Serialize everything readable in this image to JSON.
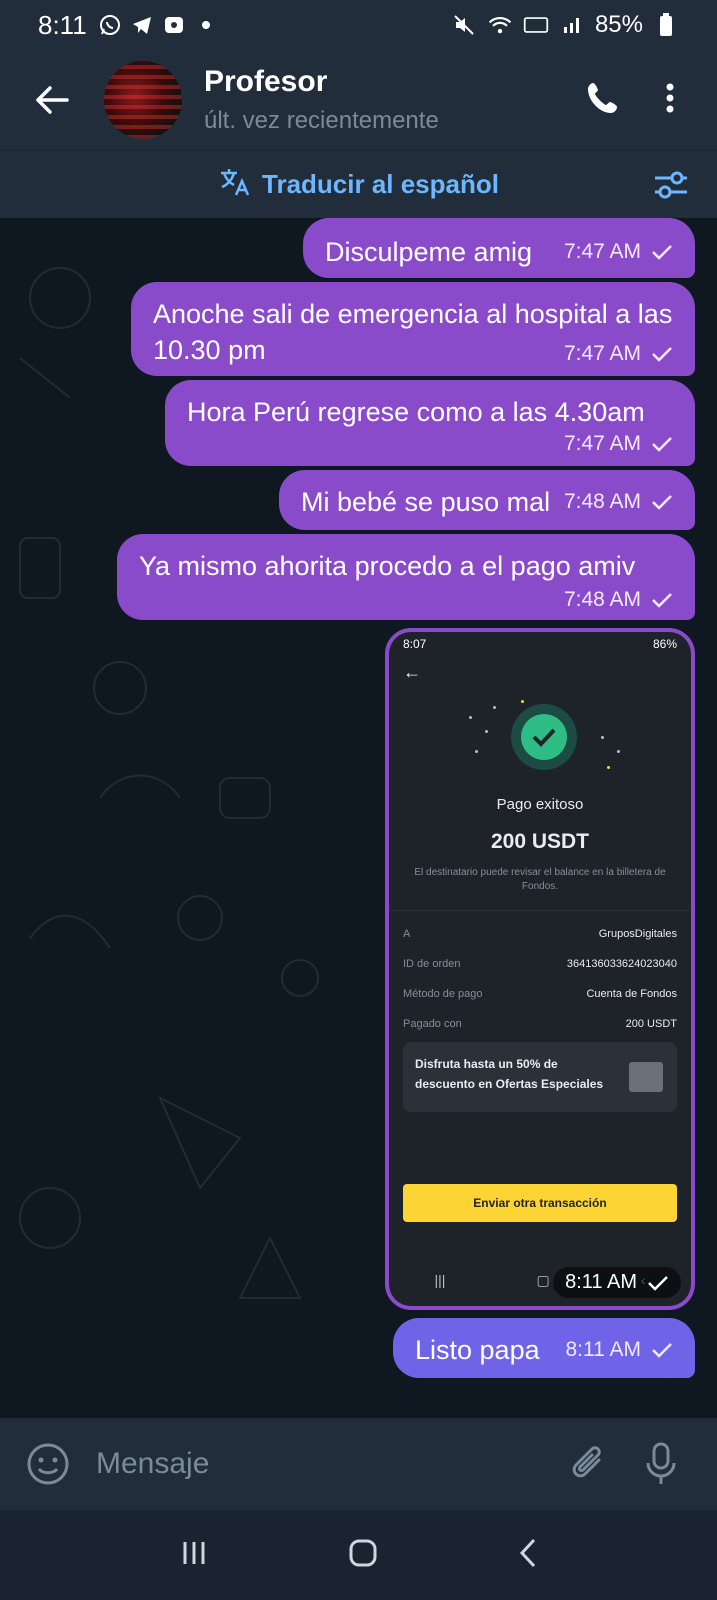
{
  "status_bar": {
    "time": "8:11",
    "battery": "85%"
  },
  "header": {
    "title": "Profesor",
    "subtitle": "últ. vez recientemente"
  },
  "translate": {
    "label": "Traducir al español"
  },
  "messages": [
    {
      "text": "Disculpeme amig",
      "time": "7:47 AM"
    },
    {
      "text": "Anoche sali de emergencia al hospital a las 10.30 pm",
      "time": "7:47 AM"
    },
    {
      "text": "Hora Perú regrese como a las 4.30am",
      "time": "7:47 AM"
    },
    {
      "text": "Mi bebé se puso mal",
      "time": "7:48 AM"
    },
    {
      "text": "Ya mismo ahorita procedo a el pago amiv",
      "time": "7:48 AM"
    },
    {
      "text": "Listo papa",
      "time": "8:11 AM"
    }
  ],
  "image_message": {
    "time": "8:11 AM",
    "screenshot": {
      "status_time": "8:07",
      "status_battery": "86%",
      "title": "Pago exitoso",
      "amount": "200 USDT",
      "note": "El destinatario puede revisar el balance en la billetera de Fondos.",
      "rows": [
        {
          "label": "A",
          "value": "GruposDigitales"
        },
        {
          "label": "ID de orden",
          "value": "364136033624023040"
        },
        {
          "label": "Método de pago",
          "value": "Cuenta de Fondos"
        },
        {
          "label": "Pagado con",
          "value": "200 USDT"
        }
      ],
      "promo": "Disfruta hasta un 50% de descuento en Ofertas Especiales",
      "button": "Enviar otra transacción",
      "colors": {
        "accent": "#fcd535",
        "success": "#2ebd85"
      }
    }
  },
  "input": {
    "placeholder": "Mensaje"
  },
  "colors": {
    "header_bg": "#212d3b",
    "outgoing_bubble": "#8a4bcb",
    "last_bubble": "#6f63e8",
    "link": "#6cb7ff"
  }
}
